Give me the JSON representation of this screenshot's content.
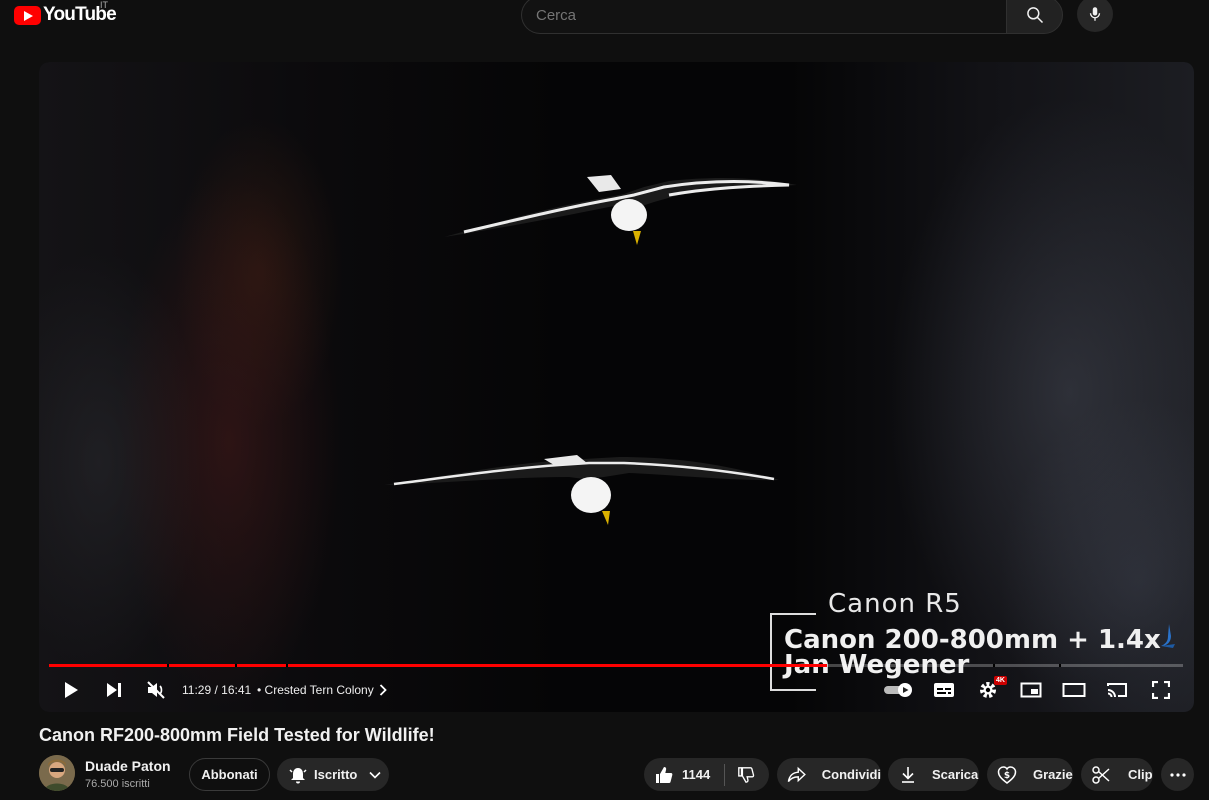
{
  "masthead": {
    "logo_text": "YouTube",
    "country_code": "IT",
    "search_placeholder": "Cerca"
  },
  "player": {
    "overlay": {
      "camera": "Canon R5",
      "lens": "Canon 200-800mm + 1.4x",
      "author": "Jan Wegener"
    },
    "progress_fraction": 0.686,
    "time_current": "11:29",
    "time_total": "16:41",
    "time_display": "11:29 / 16:41",
    "chapter_label": "• Crested Tern Colony",
    "quality_badge": "4K",
    "icons": [
      "play-icon",
      "next-icon",
      "mute-icon",
      "chevron-right-icon",
      "autoplay-toggle-icon",
      "subtitles-icon",
      "settings-icon",
      "miniplayer-icon",
      "theater-icon",
      "cast-icon",
      "fullscreen-icon"
    ]
  },
  "video": {
    "title": "Canon RF200-800mm Field Tested for Wildlife!",
    "channel_name": "Duade Paton",
    "subscribers": "76.500 iscritti"
  },
  "actions": {
    "join_label": "Abbonati",
    "subscribed_label": "Iscritto",
    "like_count": "1144",
    "share_label": "Condividi",
    "download_label": "Scarica",
    "thanks_label": "Grazie",
    "clip_label": "Clip"
  },
  "colors": {
    "background": "#0f0f0f",
    "progress": "#ff0000",
    "pill": "#272727",
    "logo_red": "#ff0000"
  }
}
